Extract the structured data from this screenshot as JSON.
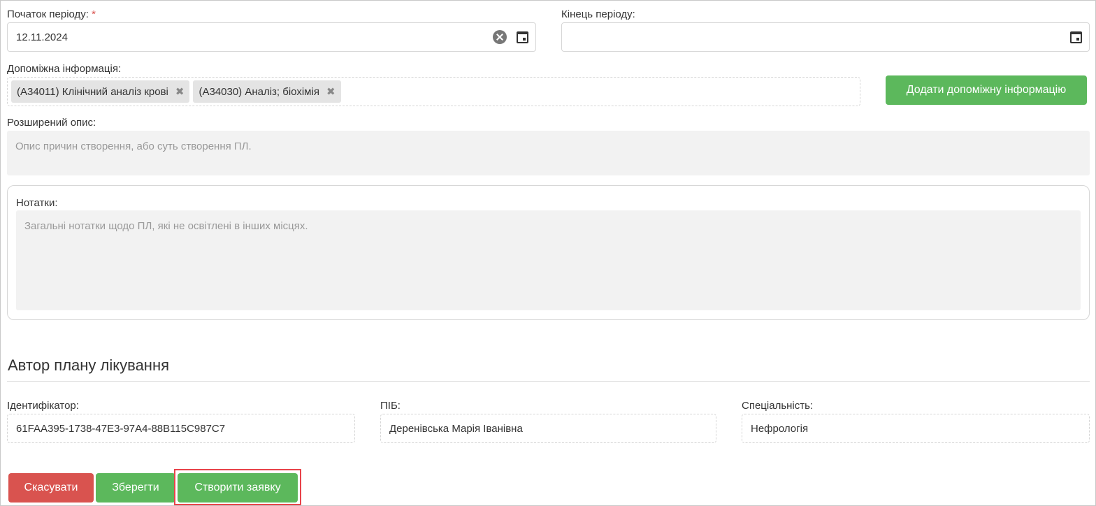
{
  "period": {
    "start_label": "Початок періоду:",
    "required_mark": "*",
    "start_value": "12.11.2024",
    "end_label": "Кінець періоду:",
    "end_value": ""
  },
  "aux_info": {
    "label": "Допоміжна інформація:",
    "tags": [
      "(A34011) Клінічний аналіз крові",
      "(A34030) Аналіз; біохімія"
    ],
    "remove_glyph": "✖",
    "add_button": "Додати допоміжну інформацію"
  },
  "description": {
    "label": "Розширений опис:",
    "placeholder": "Опис причин створення, або суть створення ПЛ."
  },
  "notes": {
    "label": "Нотатки:",
    "placeholder": "Загальні нотатки щодо ПЛ, які не освітлені в інших місцях."
  },
  "author": {
    "section_title": "Автор плану лікування",
    "id_label": "Ідентифікатор:",
    "id_value": "61FAA395-1738-47E3-97A4-88B115C987C7",
    "name_label": "ПІБ:",
    "name_value": "Деренівська Марія Іванівна",
    "specialty_label": "Спеціальність:",
    "specialty_value": "Нефрологія"
  },
  "actions": {
    "cancel": "Скасувати",
    "save": "Зберегти",
    "create_request": "Створити заявку"
  },
  "colors": {
    "green": "#5cb85c",
    "red": "#d9534f",
    "highlight": "#e8434a"
  }
}
